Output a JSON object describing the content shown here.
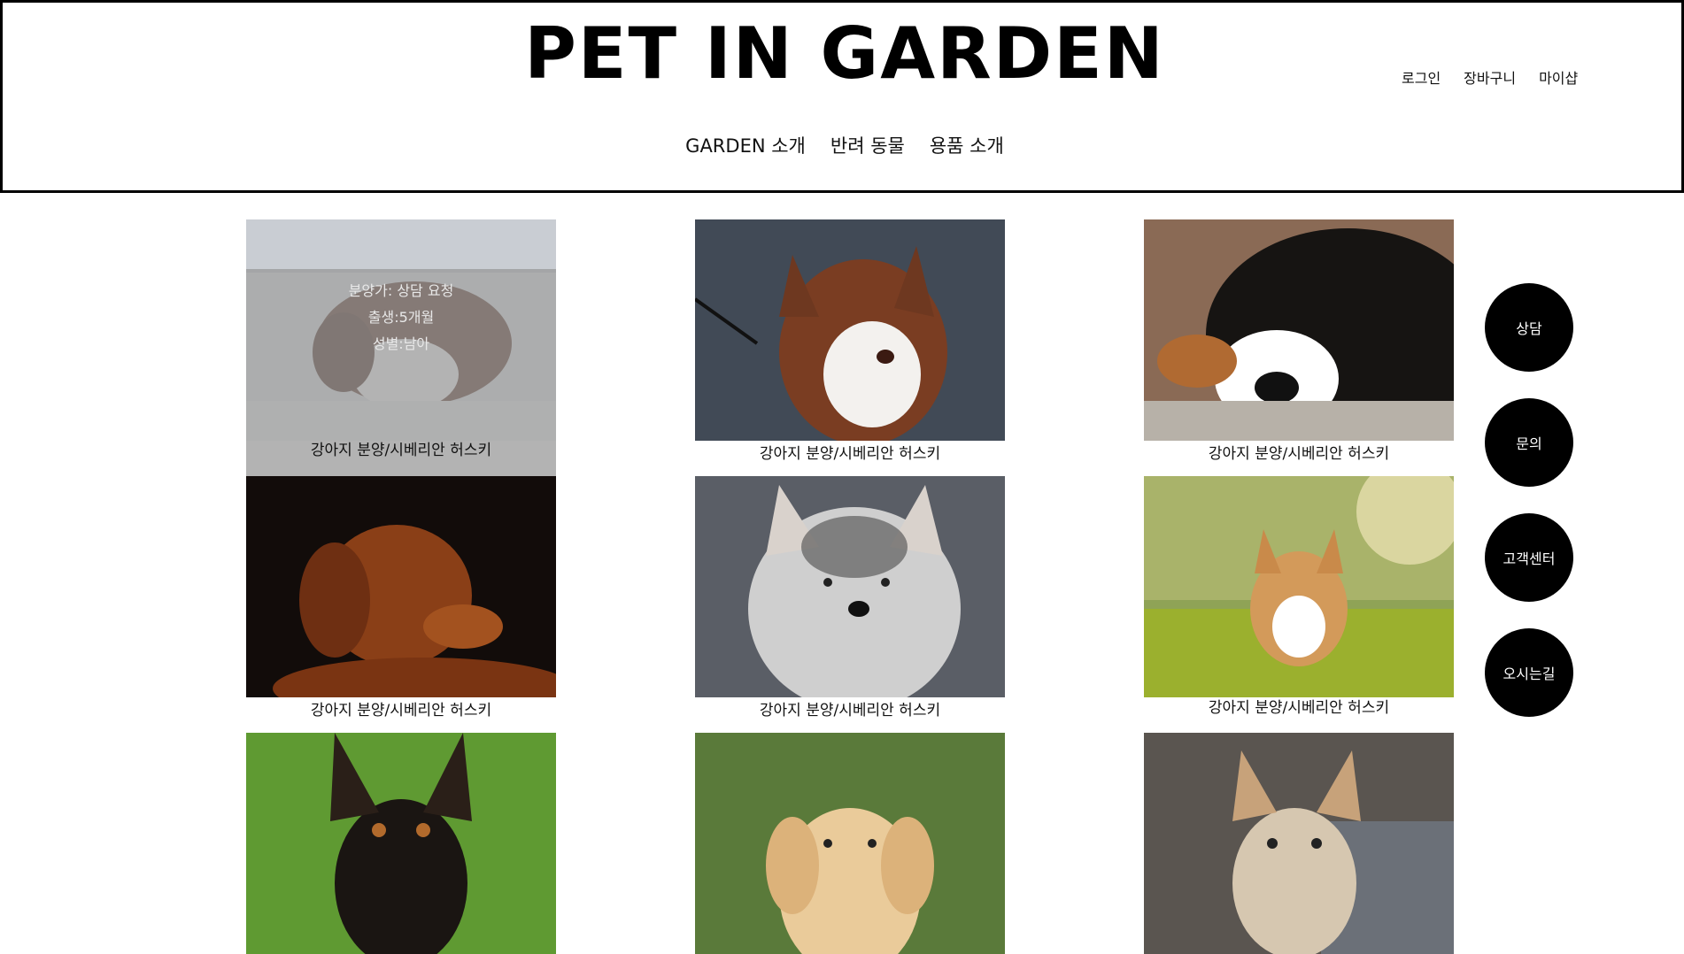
{
  "header": {
    "logo": "PET IN GARDEN",
    "util_links": [
      "로그인",
      "장바구니",
      "마이샵"
    ],
    "nav": [
      "GARDEN 소개",
      "반려 동물",
      "용품 소개"
    ]
  },
  "products": [
    {
      "caption": "강아지 분양/시베리안 허스키",
      "image": "australian-shepherd-in-snow",
      "hover": {
        "price": "분양가: 상담 요청",
        "birth": "출생:5개월",
        "sex": "성별:남아"
      }
    },
    {
      "caption": "강아지 분양/시베리안 허스키",
      "image": "red-husky-on-leash"
    },
    {
      "caption": "강아지 분양/시베리안 허스키",
      "image": "bernese-mountain-dog-lying"
    },
    {
      "caption": "강아지 분양/시베리안 허스키",
      "image": "brown-retriever-profile"
    },
    {
      "caption": "강아지 분양/시베리안 허스키",
      "image": "gray-husky-portrait"
    },
    {
      "caption": "강아지 분양/시베리안 허스키",
      "image": "corgi-on-grass"
    },
    {
      "caption": "",
      "image": "miniature-pinscher"
    },
    {
      "caption": "",
      "image": "golden-puppy"
    },
    {
      "caption": "",
      "image": "yorkshire-terrier"
    }
  ],
  "side_buttons": [
    "상담",
    "문의",
    "고객센터",
    "오시는길"
  ]
}
